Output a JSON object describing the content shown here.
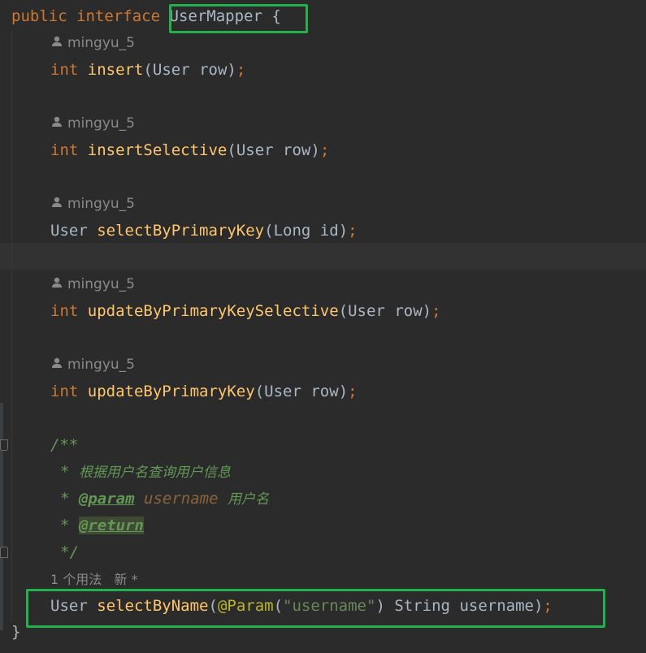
{
  "code": {
    "line1": {
      "kw1": "public",
      "kw2": "interface",
      "name": "UserMapper",
      "brace": "{"
    },
    "author": "mingyu_5",
    "m1": {
      "ret": "int",
      "name": "insert",
      "open": "(",
      "ptype": "User",
      "pname": "row",
      "close": ")",
      "semi": ";"
    },
    "m2": {
      "ret": "int",
      "name": "insertSelective",
      "open": "(",
      "ptype": "User",
      "pname": "row",
      "close": ")",
      "semi": ";"
    },
    "m3": {
      "ret": "User",
      "name": "selectByPrimaryKey",
      "open": "(",
      "ptype": "Long",
      "pname": "id",
      "close": ")",
      "semi": ";"
    },
    "m4": {
      "ret": "int",
      "name": "updateByPrimaryKeySelective",
      "open": "(",
      "ptype": "User",
      "pname": "row",
      "close": ")",
      "semi": ";"
    },
    "m5": {
      "ret": "int",
      "name": "updateByPrimaryKey",
      "open": "(",
      "ptype": "User",
      "pname": "row",
      "close": ")",
      "semi": ";"
    },
    "javadoc": {
      "start": "/**",
      "star": "*",
      "desc": "根据用户名查询用户信息",
      "param_tag": "@param",
      "param_name": "username",
      "param_desc": "用户名",
      "return_tag": "@return",
      "end": "*/"
    },
    "usage_hint": "1 个用法   新 *",
    "m6": {
      "ret": "User",
      "name": "selectByName",
      "open": "(",
      "annotation": "@Param",
      "ann_open": "(",
      "ann_value": "\"username\"",
      "ann_close": ")",
      "ptype": "String",
      "pname": "username",
      "close": ")",
      "semi": ";"
    },
    "closing_brace": "}"
  },
  "colors": {
    "background": "#2b2b2b",
    "keyword": "#cc7832",
    "method": "#ffc66d",
    "text": "#a9b7c6",
    "string": "#6a8759",
    "annotation": "#bbb529",
    "doc": "#629755",
    "highlight_box": "#22b14c"
  }
}
